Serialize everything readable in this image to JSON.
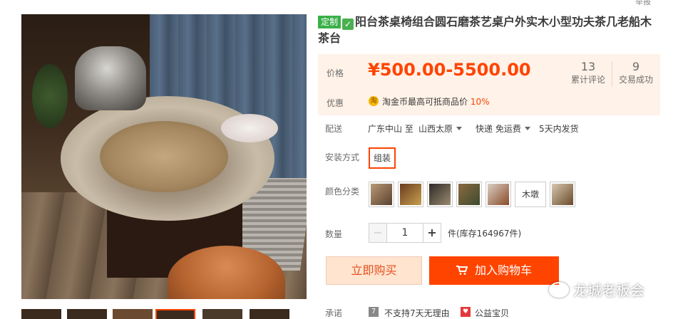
{
  "report_label": "举报",
  "product": {
    "custom_tag": "定制",
    "check_icon": "checkmark-icon",
    "title": "阳台茶桌椅组合圆石磨茶艺桌户外实木小型功夫茶几老船木茶台"
  },
  "price_panel": {
    "price_label": "价格",
    "price": "¥500.00-5500.00",
    "reviews_count": "13",
    "reviews_label": "累计评论",
    "deals_count": "9",
    "deals_label": "交易成功",
    "promo_label": "优惠",
    "promo_icon": "淘",
    "promo_text": "淘金币最高可抵商品价",
    "promo_pct": "10%"
  },
  "shipping": {
    "label": "配送",
    "from": "广东中山 至",
    "to": "山西太原",
    "method": "快递 免运费",
    "eta": "5天内发货"
  },
  "install": {
    "label": "安装方式",
    "option": "组装"
  },
  "color": {
    "label": "颜色分类",
    "text_option": "木墩",
    "swatches": [
      "#7c5a3a",
      "#4a2e1e",
      "#3a2a20",
      "#6a4a2c",
      "#8a5a36",
      "#5a3c24"
    ]
  },
  "quantity": {
    "label": "数量",
    "minus": "−",
    "value": "1",
    "plus": "+",
    "stock": "件(库存164967件)"
  },
  "actions": {
    "buy_now": "立即购买",
    "add_to_cart": "加入购物车"
  },
  "promise": {
    "label": "承诺",
    "item1_icon": "7",
    "item1": "不支持7天无理由",
    "item2_icon": "♥",
    "item2": "公益宝贝"
  },
  "watermark": "龙城老板会"
}
